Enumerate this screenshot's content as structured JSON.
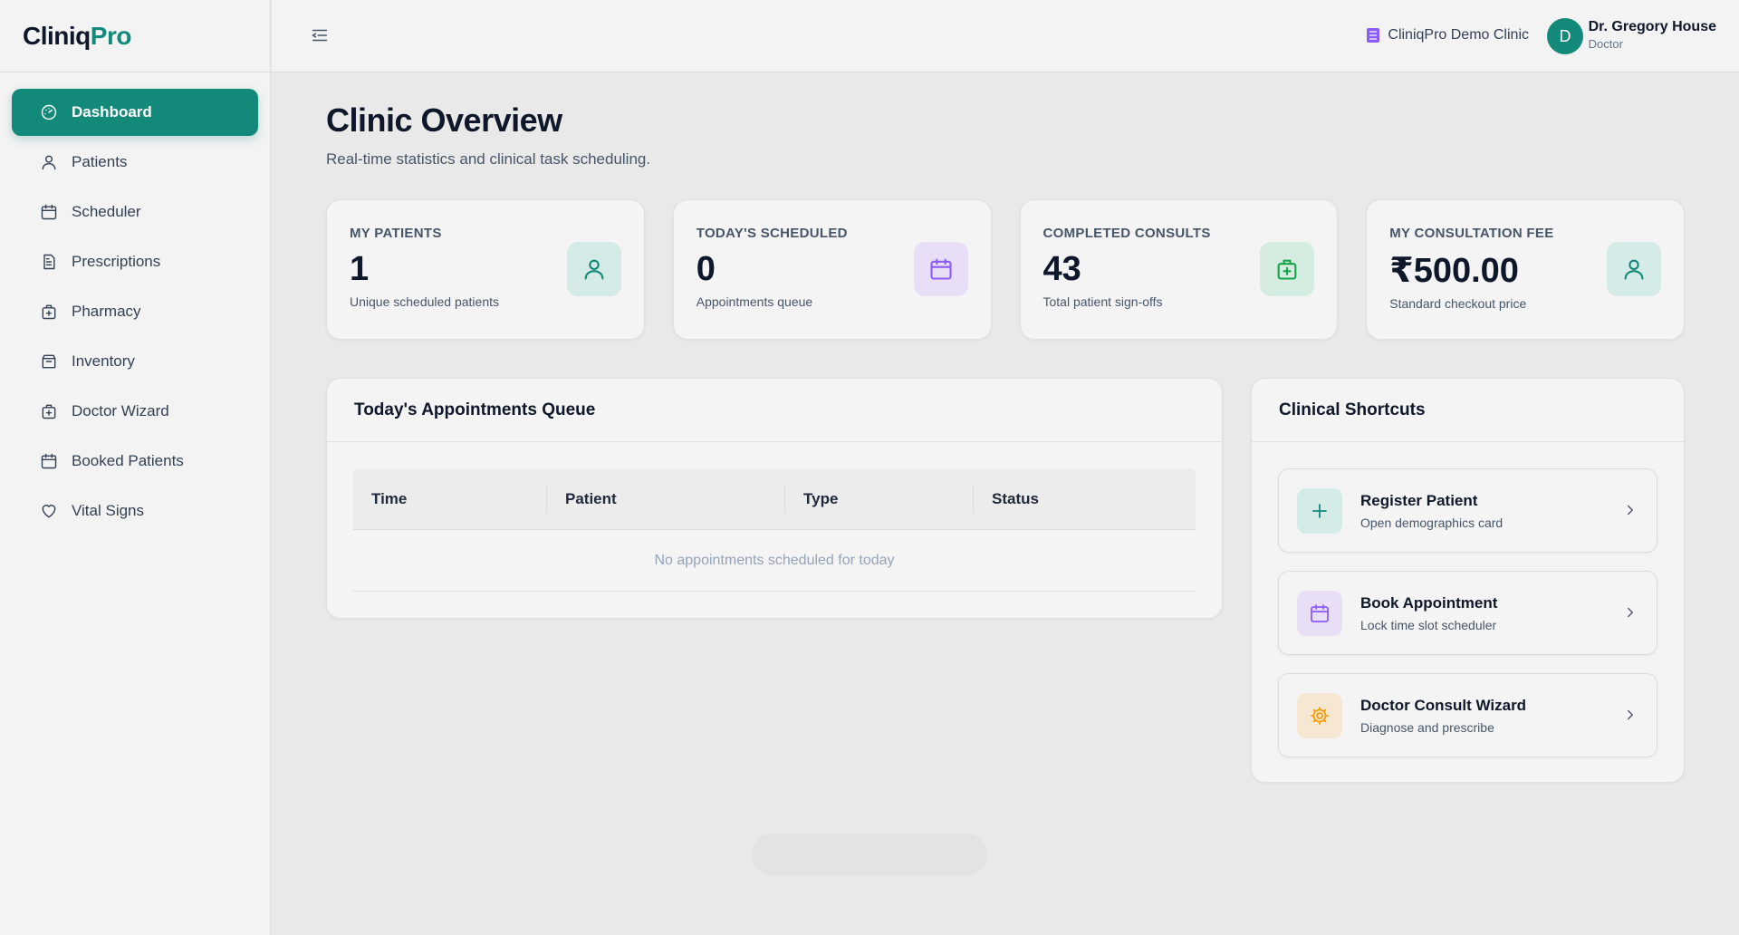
{
  "brand": {
    "part1": "Cliniq",
    "part2": "Pro"
  },
  "sidebar": {
    "items": [
      {
        "label": "Dashboard",
        "icon": "gauge-icon",
        "active": true
      },
      {
        "label": "Patients",
        "icon": "user-icon"
      },
      {
        "label": "Scheduler",
        "icon": "calendar-icon"
      },
      {
        "label": "Prescriptions",
        "icon": "document-icon"
      },
      {
        "label": "Pharmacy",
        "icon": "medical-bag-icon"
      },
      {
        "label": "Inventory",
        "icon": "box-icon"
      },
      {
        "label": "Doctor Wizard",
        "icon": "medical-bag-icon"
      },
      {
        "label": "Booked Patients",
        "icon": "calendar-icon"
      },
      {
        "label": "Vital Signs",
        "icon": "heart-icon"
      }
    ]
  },
  "topbar": {
    "clinic_name": "CliniqPro Demo Clinic",
    "avatar_initial": "D",
    "user_name": "Dr. Gregory House",
    "user_role": "Doctor"
  },
  "page": {
    "title": "Clinic Overview",
    "subtitle": "Real-time statistics and clinical task scheduling."
  },
  "stats": [
    {
      "label": "MY PATIENTS",
      "value": "1",
      "note": "Unique scheduled patients",
      "icon": "user-icon",
      "color": "#13897a"
    },
    {
      "label": "TODAY'S SCHEDULED",
      "value": "0",
      "note": "Appointments queue",
      "icon": "calendar-icon",
      "color": "#8b5cf6"
    },
    {
      "label": "COMPLETED CONSULTS",
      "value": "43",
      "note": "Total patient sign-offs",
      "icon": "medical-bag-icon",
      "color": "#16a34a"
    },
    {
      "label": "MY CONSULTATION FEE",
      "value": "₹500.00",
      "note": "Standard checkout price",
      "icon": "user-icon",
      "color": "#13897a"
    }
  ],
  "queue": {
    "title": "Today's Appointments Queue",
    "columns": [
      "Time",
      "Patient",
      "Type",
      "Status"
    ],
    "empty_message": "No appointments scheduled for today"
  },
  "shortcuts": {
    "title": "Clinical Shortcuts",
    "items": [
      {
        "title": "Register Patient",
        "subtitle": "Open demographics card",
        "icon": "plus-icon",
        "color": "#13897a"
      },
      {
        "title": "Book Appointment",
        "subtitle": "Lock time slot scheduler",
        "icon": "calendar-icon",
        "color": "#8b5cf6"
      },
      {
        "title": "Doctor Consult Wizard",
        "subtitle": "Diagnose and prescribe",
        "icon": "gear-icon",
        "color": "#f59e0b"
      }
    ]
  }
}
